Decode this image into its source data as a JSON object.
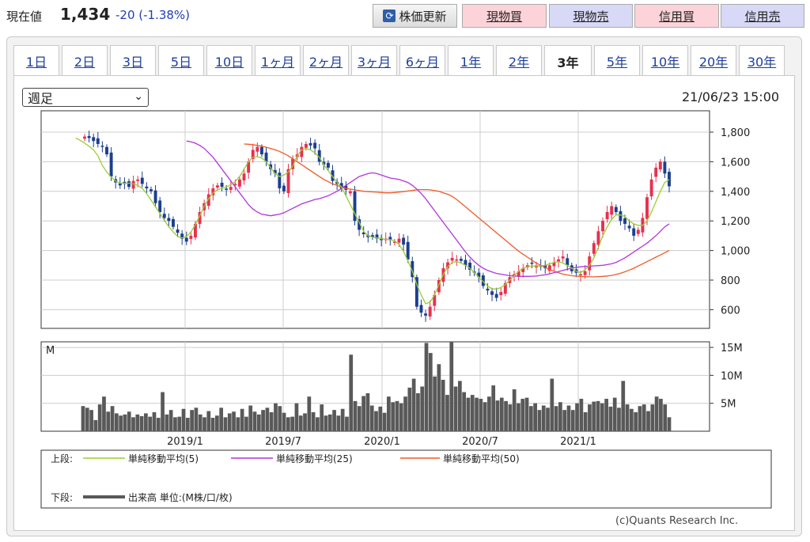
{
  "header": {
    "price_label": "現在値",
    "price_value": "1,434",
    "price_change": "-20 (-1.38%)",
    "refresh_button": "株価更新",
    "buttons": [
      "現物買",
      "現物売",
      "信用買",
      "信用売"
    ]
  },
  "period_tabs": {
    "items": [
      "1日",
      "2日",
      "3日",
      "5日",
      "10日",
      "1ヶ月",
      "2ヶ月",
      "3ヶ月",
      "6ヶ月",
      "1年",
      "2年",
      "3年",
      "5年",
      "10年",
      "20年",
      "30年"
    ],
    "active": "3年"
  },
  "controls": {
    "interval_select": "週足",
    "timestamp": "21/06/23 15:00"
  },
  "legend": {
    "upper_label": "上段:",
    "ma5": "単純移動平均(5)",
    "ma25": "単純移動平均(25)",
    "ma50": "単純移動平均(50)",
    "lower_label": "下段:",
    "volume": "出来高 単位:(M株/口/枚)"
  },
  "copyright": "(c)Quants Research Inc.",
  "colors": {
    "up": "#e8304f",
    "down": "#1c3f8f",
    "ma5": "#9acd32",
    "ma25": "#b035e0",
    "ma50": "#f05a28",
    "volume": "#595959"
  },
  "chart_data": [
    {
      "type": "candlestick",
      "interval": "weekly",
      "y_ticks": [
        "1,800",
        "1,600",
        "1,400",
        "1,200",
        "1,000",
        "800",
        "600"
      ],
      "ylim": [
        500,
        1900
      ],
      "x_ticks": [
        "2019/1",
        "2019/7",
        "2020/1",
        "2020/7",
        "2021/1"
      ],
      "close_series": [
        1770,
        1760,
        1740,
        1720,
        1700,
        1650,
        1500,
        1460,
        1440,
        1450,
        1430,
        1470,
        1480,
        1450,
        1420,
        1400,
        1320,
        1260,
        1220,
        1200,
        1160,
        1120,
        1080,
        1060,
        1100,
        1180,
        1260,
        1320,
        1380,
        1420,
        1440,
        1430,
        1410,
        1430,
        1450,
        1480,
        1520,
        1600,
        1680,
        1700,
        1650,
        1600,
        1550,
        1520,
        1420,
        1400,
        1550,
        1620,
        1650,
        1700,
        1720,
        1710,
        1690,
        1600,
        1580,
        1560,
        1470,
        1450,
        1420,
        1410,
        1400,
        1200,
        1140,
        1110,
        1090,
        1090,
        1080,
        1070,
        1080,
        1070,
        1060,
        1080,
        1040,
        940,
        820,
        620,
        580,
        560,
        620,
        700,
        800,
        880,
        920,
        950,
        940,
        930,
        900,
        870,
        850,
        820,
        760,
        730,
        700,
        680,
        720,
        780,
        820,
        840,
        860,
        880,
        900,
        910,
        900,
        890,
        880,
        900,
        920,
        940,
        960,
        900,
        860,
        850,
        840,
        860,
        960,
        1050,
        1130,
        1200,
        1260,
        1300,
        1260,
        1200,
        1180,
        1150,
        1100,
        1140,
        1220,
        1360,
        1480,
        1560,
        1600,
        1520,
        1434
      ],
      "ma5_series": [
        1760,
        1745,
        1725,
        1705,
        1680,
        1640,
        1575,
        1530,
        1495,
        1470,
        1455,
        1455,
        1455,
        1450,
        1440,
        1420,
        1385,
        1340,
        1295,
        1250,
        1205,
        1160,
        1125,
        1095,
        1085,
        1095,
        1125,
        1175,
        1235,
        1300,
        1350,
        1390,
        1410,
        1420,
        1430,
        1445,
        1465,
        1500,
        1550,
        1600,
        1630,
        1635,
        1625,
        1600,
        1560,
        1520,
        1500,
        1510,
        1530,
        1570,
        1640,
        1680,
        1690,
        1680,
        1660,
        1630,
        1580,
        1540,
        1500,
        1460,
        1430,
        1370,
        1310,
        1250,
        1190,
        1130,
        1100,
        1090,
        1085,
        1080,
        1075,
        1073,
        1065,
        1040,
        995,
        930,
        860,
        770,
        700,
        640,
        650,
        700,
        770,
        840,
        890,
        920,
        925,
        915,
        900,
        880,
        850,
        820,
        790,
        760,
        740,
        740,
        750,
        770,
        800,
        830,
        860,
        880,
        890,
        895,
        895,
        895,
        900,
        910,
        920,
        925,
        915,
        900,
        880,
        860,
        850,
        870,
        900,
        950,
        1020,
        1100,
        1160,
        1210,
        1240,
        1240,
        1230,
        1200,
        1180,
        1170,
        1170,
        1200,
        1260,
        1330,
        1400,
        1460,
        1480
      ],
      "ma25_series": [
        1740,
        1735,
        1725,
        1710,
        1690,
        1660,
        1630,
        1590,
        1550,
        1510,
        1470,
        1430,
        1390,
        1350,
        1310,
        1280,
        1260,
        1245,
        1240,
        1235,
        1240,
        1245,
        1255,
        1270,
        1285,
        1300,
        1315,
        1325,
        1335,
        1345,
        1350,
        1360,
        1370,
        1385,
        1400,
        1420,
        1440,
        1460,
        1480,
        1500,
        1510,
        1520,
        1525,
        1520,
        1510,
        1500,
        1490,
        1485,
        1480,
        1470,
        1460,
        1440,
        1415,
        1385,
        1350,
        1310,
        1270,
        1230,
        1190,
        1150,
        1110,
        1070,
        1030,
        990,
        955,
        925,
        900,
        880,
        865,
        855,
        845,
        840,
        835,
        830,
        828,
        826,
        825,
        825,
        826,
        828,
        832,
        836,
        842,
        850,
        858,
        866,
        874,
        880,
        886,
        890,
        892,
        894,
        896,
        898,
        900,
        905,
        910,
        920,
        935,
        950,
        970,
        990,
        1010,
        1030,
        1050,
        1075,
        1100,
        1130,
        1160,
        1180
      ],
      "ma50_series": [
        1720,
        1718,
        1715,
        1710,
        1705,
        1698,
        1690,
        1680,
        1670,
        1655,
        1640,
        1620,
        1600,
        1580,
        1560,
        1540,
        1520,
        1500,
        1480,
        1465,
        1450,
        1440,
        1430,
        1420,
        1415,
        1410,
        1405,
        1400,
        1398,
        1396,
        1394,
        1392,
        1390,
        1390,
        1392,
        1395,
        1398,
        1402,
        1406,
        1410,
        1412,
        1412,
        1410,
        1405,
        1400,
        1390,
        1380,
        1365,
        1345,
        1320,
        1295,
        1270,
        1245,
        1220,
        1195,
        1170,
        1145,
        1120,
        1095,
        1070,
        1045,
        1020,
        995,
        975,
        955,
        935,
        915,
        900,
        885,
        870,
        860,
        850,
        840,
        835,
        830,
        827,
        825,
        823,
        822,
        822,
        823,
        825,
        828,
        832,
        838,
        846,
        856,
        868,
        880,
        895,
        910,
        925,
        940,
        955,
        970,
        985,
        1000
      ],
      "candle_count": 133
    },
    {
      "type": "bar",
      "name": "出来高",
      "unit": "M",
      "y_ticks": [
        "15M",
        "10M",
        "5M"
      ],
      "ylim": [
        0,
        16
      ],
      "values": [
        4.5,
        4.2,
        3.8,
        2.0,
        4.8,
        6.2,
        3.5,
        4.5,
        3.2,
        2.8,
        3.0,
        3.5,
        2.5,
        3.0,
        2.7,
        3.2,
        2.6,
        3.4,
        2.4,
        7.0,
        3.0,
        3.8,
        2.5,
        2.6,
        4.0,
        2.4,
        3.8,
        4.2,
        3.0,
        2.5,
        3.6,
        2.4,
        2.8,
        4.2,
        2.5,
        3.2,
        3.5,
        2.5,
        4.0,
        2.6,
        4.6,
        3.5,
        3.0,
        3.8,
        4.2,
        3.4,
        5.0,
        4.5,
        3.3,
        2.5,
        2.6,
        5.0,
        2.8,
        3.2,
        6.2,
        3.4,
        2.5,
        4.8,
        2.8,
        3.0,
        3.8,
        2.8,
        4.0,
        2.6,
        13.7,
        5.4,
        4.5,
        6.3,
        6.8,
        4.6,
        3.6,
        4.4,
        3.3,
        6.2,
        5.2,
        5.4,
        5.0,
        6.2,
        7.8,
        9.4,
        6.8,
        8.0,
        15.8,
        14.0,
        9.8,
        12.0,
        9.2,
        6.5,
        16.0,
        8.0,
        9.0,
        7.0,
        6.0,
        6.5,
        6.0,
        5.8,
        5.2,
        6.2,
        8.2,
        5.5,
        6.0,
        5.4,
        4.8,
        7.5,
        5.0,
        5.8,
        6.0,
        4.5,
        5.0,
        3.8,
        4.6,
        4.2,
        9.4,
        4.5,
        5.2,
        3.8,
        4.6,
        3.8,
        5.0,
        5.8,
        3.4,
        4.8,
        5.3,
        5.4,
        5.0,
        5.8,
        4.4,
        6.0,
        4.2,
        9.0,
        4.8,
        4.0,
        3.4,
        4.5,
        4.8,
        3.6,
        4.8,
        6.2,
        5.8,
        4.8,
        2.5
      ]
    }
  ]
}
